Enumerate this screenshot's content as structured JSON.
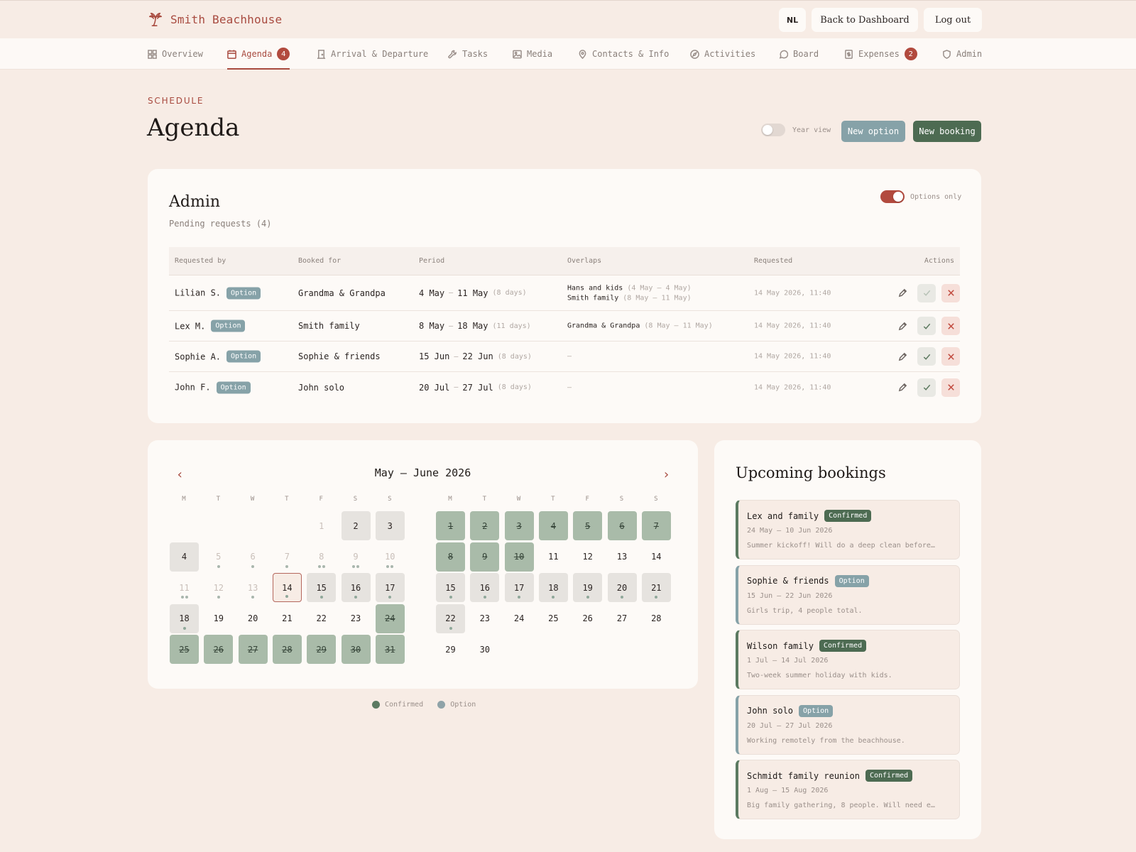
{
  "brand": {
    "name": "Smith Beachhouse"
  },
  "header": {
    "lang": "NL",
    "back": "Back to Dashboard",
    "logout": "Log out"
  },
  "tabs": [
    {
      "label": "Overview"
    },
    {
      "label": "Agenda",
      "badge": "4"
    },
    {
      "label": "Arrival & Departure"
    },
    {
      "label": "Tasks"
    },
    {
      "label": "Media"
    },
    {
      "label": "Contacts & Info"
    },
    {
      "label": "Activities"
    },
    {
      "label": "Board"
    },
    {
      "label": "Expenses",
      "badge": "2"
    },
    {
      "label": "Admin"
    }
  ],
  "page": {
    "eyebrow": "SCHEDULE",
    "title": "Agenda",
    "year_view": "Year view",
    "new_option": "New option",
    "new_booking": "New booking"
  },
  "admin": {
    "title": "Admin",
    "subtitle": "Pending requests (4)",
    "options_only": "Options only",
    "columns": [
      "Requested by",
      "Booked for",
      "Period",
      "Overlaps",
      "Requested",
      "Actions"
    ],
    "rows": [
      {
        "by": "Lilian S.",
        "tag": "Option",
        "for": "Grandma & Grandpa",
        "from": "4 May",
        "to": "11 May",
        "days": "(8 days)",
        "overlaps": [
          {
            "name": "Hans and kids",
            "range": "(4 May – 4 May)"
          },
          {
            "name": "Smith family",
            "range": "(8 May – 11 May)"
          }
        ],
        "requested": "14 May 2026, 11:40"
      },
      {
        "by": "Lex M.",
        "tag": "Option",
        "for": "Smith family",
        "from": "8 May",
        "to": "18 May",
        "days": "(11 days)",
        "overlaps": [
          {
            "name": "Grandma & Grandpa",
            "range": "(8 May – 11 May)"
          }
        ],
        "requested": "14 May 2026, 11:40"
      },
      {
        "by": "Sophie A.",
        "tag": "Option",
        "for": "Sophie & friends",
        "from": "15 Jun",
        "to": "22 Jun",
        "days": "(8 days)",
        "overlaps": [],
        "overlap_empty": "–",
        "requested": "14 May 2026, 11:40"
      },
      {
        "by": "John F.",
        "tag": "Option",
        "for": "John solo",
        "from": "20 Jul",
        "to": "27 Jul",
        "days": "(8 days)",
        "overlaps": [],
        "overlap_empty": "–",
        "requested": "14 May 2026, 11:40"
      }
    ],
    "range_sep": "–"
  },
  "calendar": {
    "title": "May – June 2026",
    "weekdays": [
      "M",
      "T",
      "W",
      "T",
      "F",
      "S",
      "S"
    ],
    "may": {
      "offset": 4,
      "days": [
        {
          "n": "1",
          "s": "faded"
        },
        {
          "n": "2",
          "s": "grey"
        },
        {
          "n": "3",
          "s": "grey"
        },
        {
          "n": "4",
          "s": "grey"
        },
        {
          "n": "5",
          "s": "faded",
          "d": 1
        },
        {
          "n": "6",
          "s": "faded",
          "d": 1
        },
        {
          "n": "7",
          "s": "faded",
          "d": 1
        },
        {
          "n": "8",
          "s": "faded",
          "d": 2
        },
        {
          "n": "9",
          "s": "faded",
          "d": 2
        },
        {
          "n": "10",
          "s": "faded",
          "d": 2
        },
        {
          "n": "11",
          "s": "faded",
          "d": 2
        },
        {
          "n": "12",
          "s": "faded",
          "d": 1
        },
        {
          "n": "13",
          "s": "faded",
          "d": 1
        },
        {
          "n": "14",
          "s": "today",
          "d": 1
        },
        {
          "n": "15",
          "s": "grey",
          "d": 1
        },
        {
          "n": "16",
          "s": "grey",
          "d": 1
        },
        {
          "n": "17",
          "s": "grey",
          "d": 1
        },
        {
          "n": "18",
          "s": "grey",
          "d": 1
        },
        {
          "n": "19",
          "s": ""
        },
        {
          "n": "20",
          "s": ""
        },
        {
          "n": "21",
          "s": ""
        },
        {
          "n": "22",
          "s": ""
        },
        {
          "n": "23",
          "s": ""
        },
        {
          "n": "24",
          "s": "conf-strike"
        },
        {
          "n": "25",
          "s": "conf-strike"
        },
        {
          "n": "26",
          "s": "conf-strike"
        },
        {
          "n": "27",
          "s": "conf-strike"
        },
        {
          "n": "28",
          "s": "conf-strike"
        },
        {
          "n": "29",
          "s": "conf-strike"
        },
        {
          "n": "30",
          "s": "conf-strike"
        },
        {
          "n": "31",
          "s": "conf-strike"
        }
      ]
    },
    "june": {
      "offset": 0,
      "days": [
        {
          "n": "1",
          "s": "conf-strike"
        },
        {
          "n": "2",
          "s": "conf-strike"
        },
        {
          "n": "3",
          "s": "conf-strike"
        },
        {
          "n": "4",
          "s": "conf-strike"
        },
        {
          "n": "5",
          "s": "conf-strike"
        },
        {
          "n": "6",
          "s": "conf-strike"
        },
        {
          "n": "7",
          "s": "conf-strike"
        },
        {
          "n": "8",
          "s": "conf-strike"
        },
        {
          "n": "9",
          "s": "conf-strike"
        },
        {
          "n": "10",
          "s": "conf-strike"
        },
        {
          "n": "11",
          "s": ""
        },
        {
          "n": "12",
          "s": ""
        },
        {
          "n": "13",
          "s": ""
        },
        {
          "n": "14",
          "s": ""
        },
        {
          "n": "15",
          "s": "grey",
          "d": 1
        },
        {
          "n": "16",
          "s": "grey",
          "d": 1
        },
        {
          "n": "17",
          "s": "grey",
          "d": 1
        },
        {
          "n": "18",
          "s": "grey",
          "d": 1
        },
        {
          "n": "19",
          "s": "grey",
          "d": 1
        },
        {
          "n": "20",
          "s": "grey",
          "d": 1
        },
        {
          "n": "21",
          "s": "grey",
          "d": 1
        },
        {
          "n": "22",
          "s": "grey",
          "d": 1
        },
        {
          "n": "23",
          "s": ""
        },
        {
          "n": "24",
          "s": ""
        },
        {
          "n": "25",
          "s": ""
        },
        {
          "n": "26",
          "s": ""
        },
        {
          "n": "27",
          "s": ""
        },
        {
          "n": "28",
          "s": ""
        },
        {
          "n": "29",
          "s": ""
        },
        {
          "n": "30",
          "s": ""
        }
      ]
    },
    "legend": {
      "confirmed": "Confirmed",
      "option": "Option"
    },
    "colors": {
      "confirmed": "#5b7a61",
      "option": "#8fa3a8"
    }
  },
  "upcoming": {
    "title": "Upcoming bookings",
    "items": [
      {
        "name": "Lex and family",
        "status": "Confirmed",
        "dates": "24 May – 10 Jun 2026",
        "note": "Summer kickoff! Will do a deep clean before…"
      },
      {
        "name": "Sophie & friends",
        "status": "Option",
        "dates": "15 Jun – 22 Jun 2026",
        "note": "Girls trip, 4 people total."
      },
      {
        "name": "Wilson family",
        "status": "Confirmed",
        "dates": "1 Jul – 14 Jul 2026",
        "note": "Two-week summer holiday with kids."
      },
      {
        "name": "John solo",
        "status": "Option",
        "dates": "20 Jul – 27 Jul 2026",
        "note": "Working remotely from the beachhouse."
      },
      {
        "name": "Schmidt family reunion",
        "status": "Confirmed",
        "dates": "1 Aug – 15 Aug 2026",
        "note": "Big family gathering, 8 people. Will need e…"
      }
    ]
  }
}
